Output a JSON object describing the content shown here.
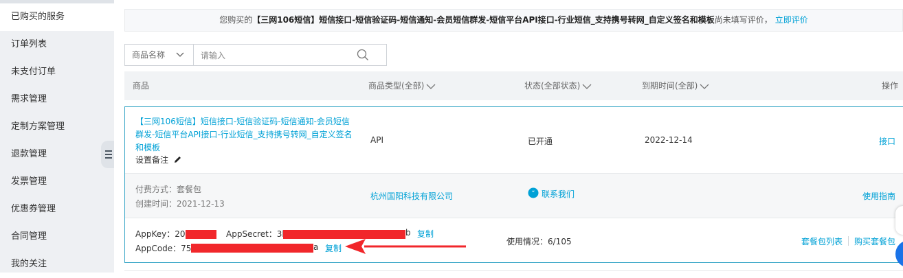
{
  "sidebar": {
    "items": [
      {
        "label": "已购买的服务",
        "active": true
      },
      {
        "label": "订单列表"
      },
      {
        "label": "未支付订单"
      },
      {
        "label": "需求管理"
      },
      {
        "label": "定制方案管理"
      },
      {
        "label": "退款管理"
      },
      {
        "label": "发票管理"
      },
      {
        "label": "优惠券管理"
      },
      {
        "label": "合同管理"
      },
      {
        "label": "我的关注"
      }
    ]
  },
  "notice": {
    "prefix": "您购买的",
    "product": "【三网106短信】短信接口-短信验证码-短信通知-会员短信群发-短信平台API接口-行业短信_支持携号转网_自定义签名和模板",
    "suffix": "尚未填写评价，",
    "link": "立即评价"
  },
  "search": {
    "select_label": "商品名称",
    "placeholder": "请输入"
  },
  "table": {
    "headers": {
      "product": "商品",
      "type": "商品类型(全部)",
      "status": "状态(全部状态)",
      "expire": "到期时间(全部)",
      "action": "操作"
    }
  },
  "order": {
    "product_name": "【三网106短信】短信接口-短信验证码-短信通知-会员短信群发-短信平台API接口-行业短信_支持携号转网_自定义签名和模板",
    "remark_label": "设置备注",
    "type": "API",
    "status": "已开通",
    "expire_date": "2022-12-14",
    "action_interface": "接口",
    "payment_method": "付费方式：套餐包",
    "created_time": "创建时间：2021-12-13",
    "vendor": "杭州国阳科技有限公司",
    "contact_label": "联系我们",
    "guide_label": "使用指南",
    "appkey_label": "AppKey：20",
    "appsecret_label": "AppSecret：3h",
    "appsecret_tail": "b",
    "copy1": "复制",
    "appcode_label": "AppCode：750",
    "appcode_tail": "a",
    "copy2": "复制",
    "usage": "使用情况：6/105",
    "package_list": "套餐包列表",
    "buy_package": "购买套餐包"
  },
  "colors": {
    "accent": "#00a1d6",
    "redaction": "#f1272b",
    "sidebar_bg": "#eef0f3"
  }
}
